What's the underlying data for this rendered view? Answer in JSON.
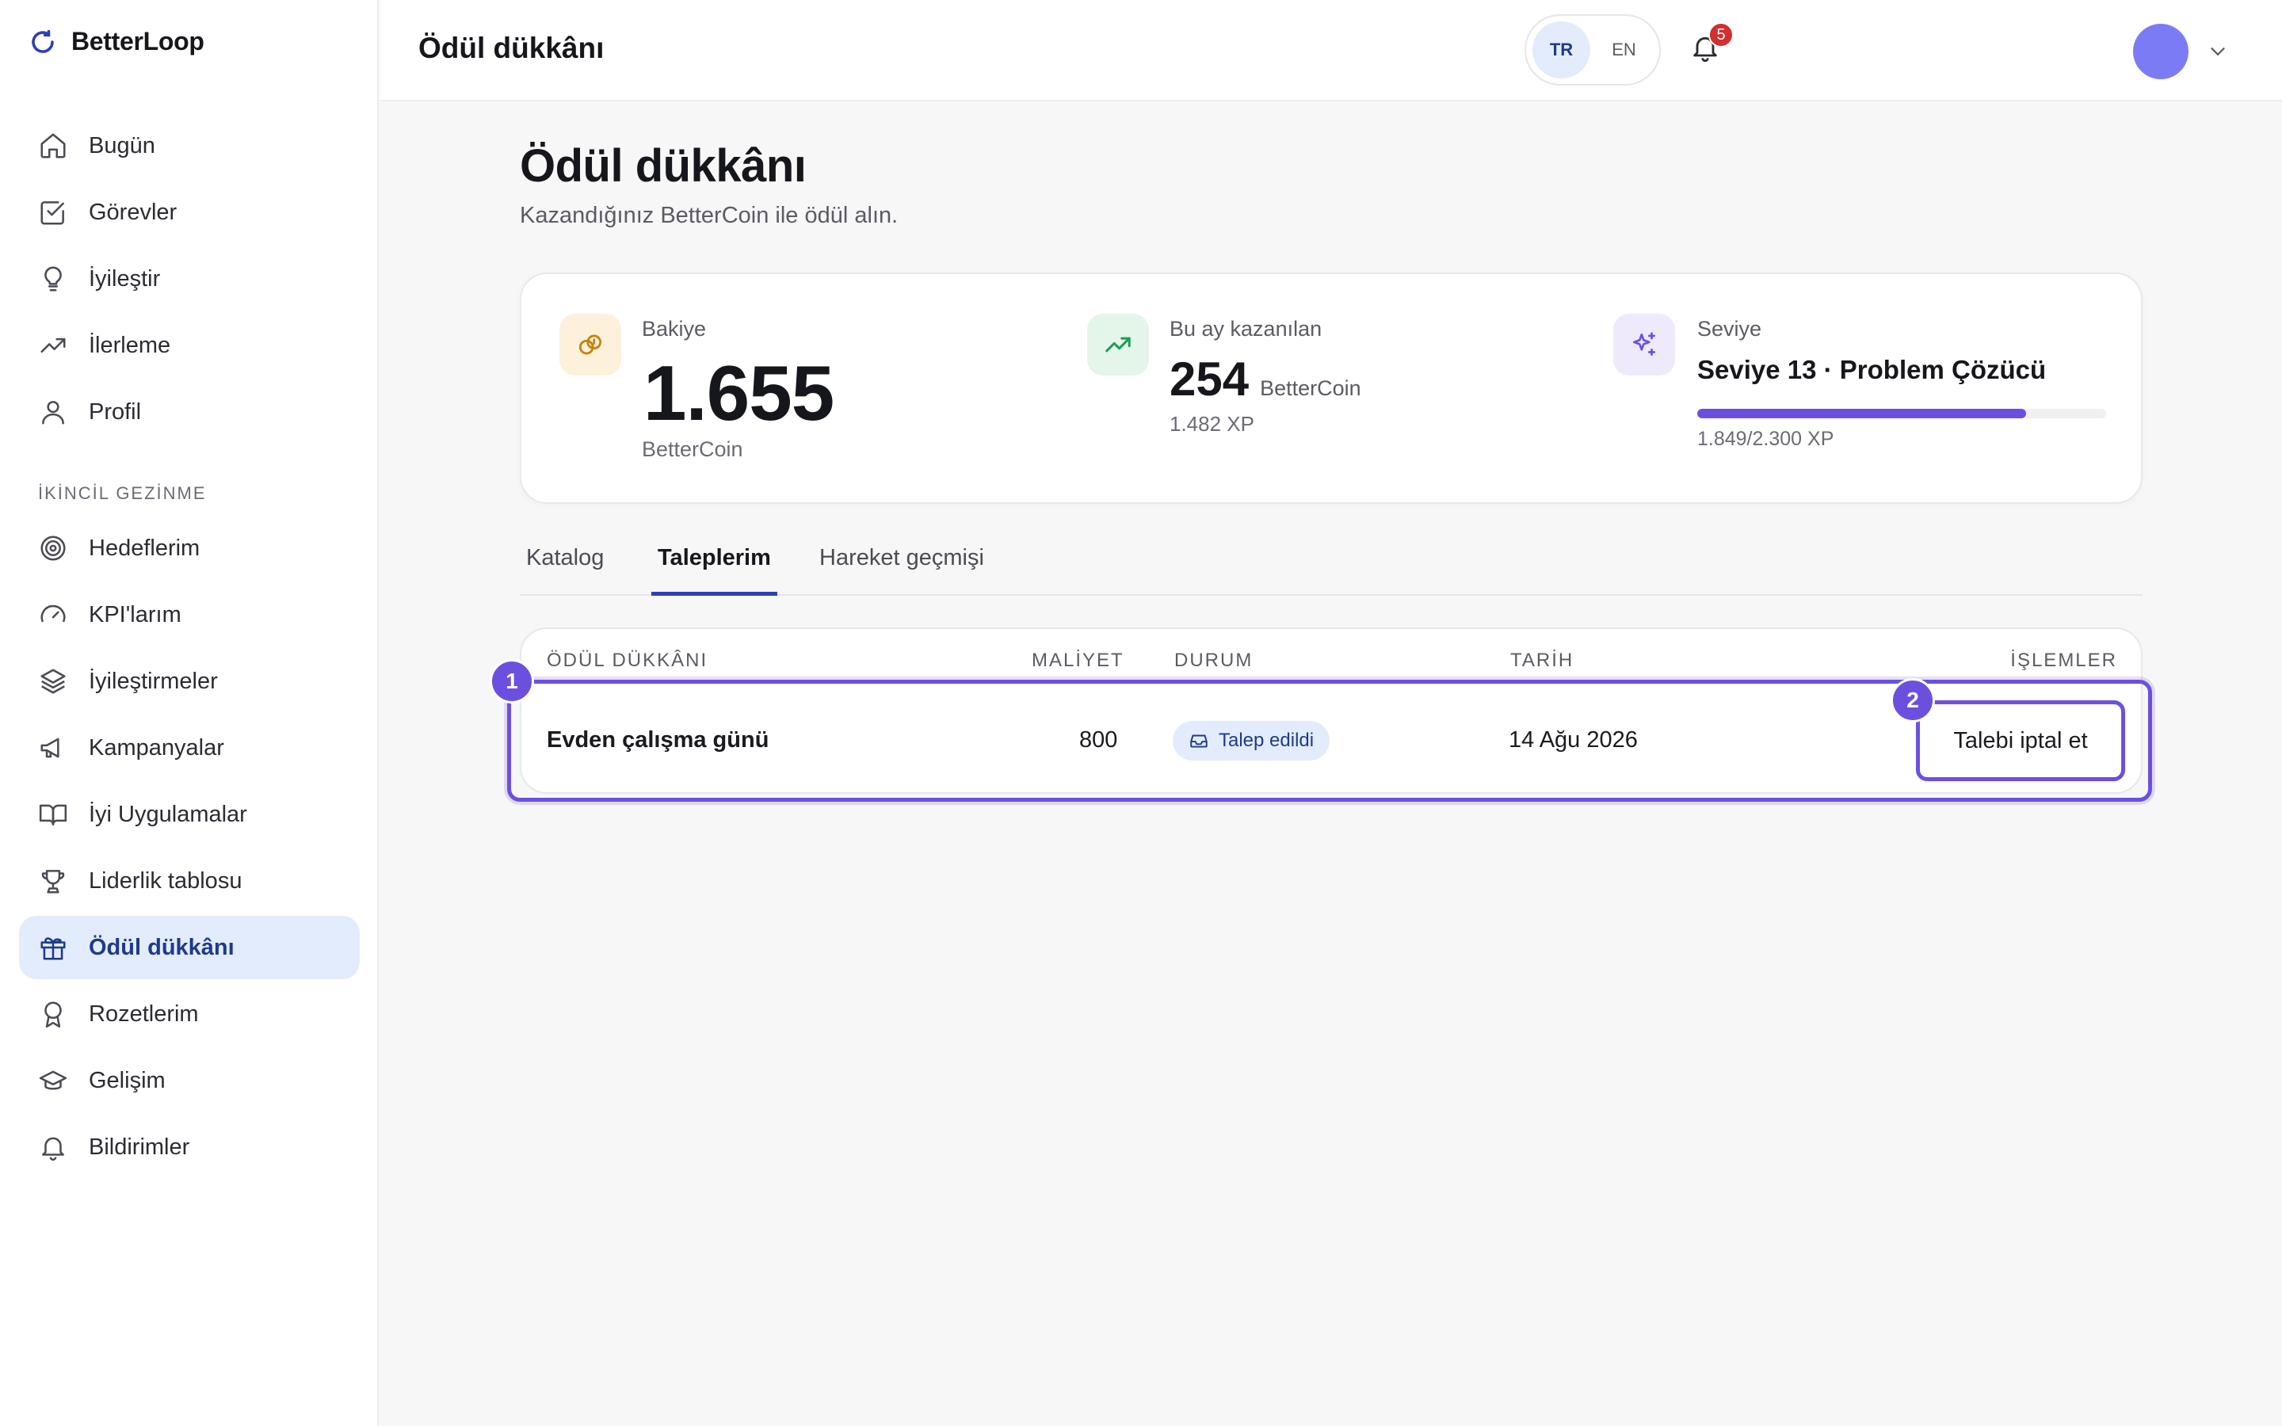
{
  "app": {
    "name": "BetterLoop"
  },
  "sidebar": {
    "primary": [
      {
        "label": "Bugün",
        "icon": "home-icon"
      },
      {
        "label": "Görevler",
        "icon": "checkbox-icon"
      },
      {
        "label": "İyileştir",
        "icon": "lightbulb-icon"
      },
      {
        "label": "İlerleme",
        "icon": "trending-up-icon"
      },
      {
        "label": "Profil",
        "icon": "user-icon"
      }
    ],
    "secondary_heading": "İKİNCİL GEZİNME",
    "secondary": [
      {
        "label": "Hedeflerim",
        "icon": "target-icon"
      },
      {
        "label": "KPI'larım",
        "icon": "gauge-icon"
      },
      {
        "label": "İyileştirmeler",
        "icon": "layers-icon"
      },
      {
        "label": "Kampanyalar",
        "icon": "megaphone-icon"
      },
      {
        "label": "İyi Uygulamalar",
        "icon": "book-icon"
      },
      {
        "label": "Liderlik tablosu",
        "icon": "trophy-icon"
      },
      {
        "label": "Ödül dükkânı",
        "icon": "gift-icon",
        "active": true
      },
      {
        "label": "Rozetlerim",
        "icon": "award-icon"
      },
      {
        "label": "Gelişim",
        "icon": "graduation-cap-icon"
      },
      {
        "label": "Bildirimler",
        "icon": "bell-icon"
      }
    ]
  },
  "topbar": {
    "title": "Ödül dükkânı",
    "languages": [
      "TR",
      "EN"
    ],
    "active_language": "TR",
    "notification_count": "5"
  },
  "page": {
    "title": "Ödül dükkânı",
    "subtitle": "Kazandığınız BetterCoin ile ödül alın."
  },
  "stats": {
    "balance": {
      "label": "Bakiye",
      "value": "1.655",
      "unit": "BetterCoin"
    },
    "monthly": {
      "label": "Bu ay kazanılan",
      "value": "254",
      "unit": "BetterCoin",
      "xp": "1.482 XP"
    },
    "level": {
      "label": "Seviye",
      "title": "Seviye 13 · Problem Çözücü",
      "progress_text": "1.849/2.300 XP",
      "progress": 0.804
    }
  },
  "tabs": [
    {
      "label": "Katalog"
    },
    {
      "label": "Taleplerim",
      "active": true
    },
    {
      "label": "Hareket geçmişi"
    }
  ],
  "table": {
    "headers": {
      "reward": "ÖDÜL DÜKKÂNI",
      "cost": "MALİYET",
      "status": "DURUM",
      "date": "TARİH",
      "actions": "İŞLEMLER"
    },
    "rows": [
      {
        "reward": "Evden çalışma günü",
        "cost": "800",
        "status": "Talep edildi",
        "date": "14 Ağu 2026",
        "action": "Talebi iptal et"
      }
    ]
  },
  "markers": [
    "1",
    "2"
  ],
  "colors": {
    "accent": "#6d4fe0",
    "active_nav_bg": "#e3ecfc",
    "active_text": "#1e3a8a",
    "badge": "#d32f2f"
  }
}
